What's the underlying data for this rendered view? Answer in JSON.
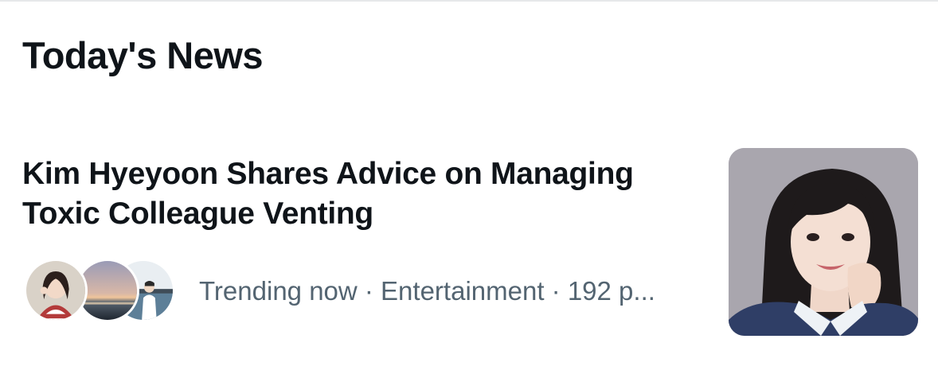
{
  "section": {
    "title": "Today's News"
  },
  "news_item": {
    "headline": "Kim Hyeyoon Shares Advice on Managing Toxic Colleague Venting",
    "meta": "Trending now · Entertainment · 192 p...",
    "avatars": [
      "avatar-portrait-icon",
      "avatar-sunset-icon",
      "avatar-seaside-icon"
    ],
    "thumbnail": "news-thumbnail-portrait"
  },
  "colors": {
    "text_primary": "#0f1419",
    "text_secondary": "#536471",
    "divider": "#e6e8ea",
    "background": "#ffffff"
  }
}
